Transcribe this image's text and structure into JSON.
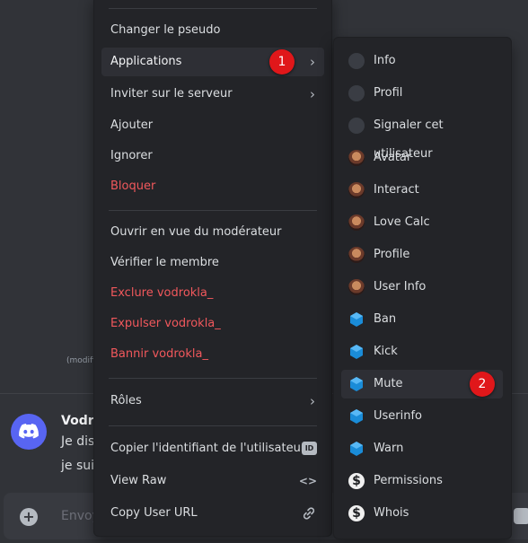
{
  "background": {
    "modified_text": "(modifi",
    "author": "Vodro",
    "line1": "Je dis",
    "line2": "je suis",
    "composer_placeholder": "Envoy"
  },
  "user_menu": {
    "items": [
      {
        "label": "Changer le pseudo"
      },
      {
        "label": "Applications",
        "badge": "1"
      },
      {
        "label": "Inviter sur le serveur"
      },
      {
        "label": "Ajouter"
      },
      {
        "label": "Ignorer"
      },
      {
        "label": "Bloquer"
      },
      {
        "label": "Ouvrir en vue du modérateur"
      },
      {
        "label": "Vérifier le membre"
      },
      {
        "label": "Exclure vodrokla_"
      },
      {
        "label": "Expulser vodrokla_"
      },
      {
        "label": "Bannir vodrokla_"
      },
      {
        "label": "Rôles"
      },
      {
        "label": "Copier l'identifiant de l'utilisateur"
      },
      {
        "label": "View Raw"
      },
      {
        "label": "Copy User URL"
      }
    ],
    "id_icon_text": "ID"
  },
  "apps_menu": {
    "items": [
      {
        "label": "Info",
        "icon": "wolf-app-icon"
      },
      {
        "label": "Profil",
        "icon": "wolf-app-icon"
      },
      {
        "label": "Signaler cet utilisateur",
        "icon": "wolf-app-icon"
      },
      {
        "label": "Avatar",
        "icon": "anime-app-icon"
      },
      {
        "label": "Interact",
        "icon": "anime-app-icon"
      },
      {
        "label": "Love Calc",
        "icon": "anime-app-icon"
      },
      {
        "label": "Profile",
        "icon": "anime-app-icon"
      },
      {
        "label": "User Info",
        "icon": "anime-app-icon"
      },
      {
        "label": "Ban",
        "icon": "blue-cube-icon"
      },
      {
        "label": "Kick",
        "icon": "blue-cube-icon"
      },
      {
        "label": "Mute",
        "icon": "blue-cube-icon",
        "badge": "2"
      },
      {
        "label": "Userinfo",
        "icon": "blue-cube-icon"
      },
      {
        "label": "Warn",
        "icon": "blue-cube-icon"
      },
      {
        "label": "Permissions",
        "icon": "dollar-s-icon"
      },
      {
        "label": "Whois",
        "icon": "dollar-s-icon"
      }
    ]
  },
  "colors": {
    "danger": "#f1585c",
    "badge": "#e0171a",
    "menu_bg": "#232428",
    "blurple": "#5865f2"
  }
}
